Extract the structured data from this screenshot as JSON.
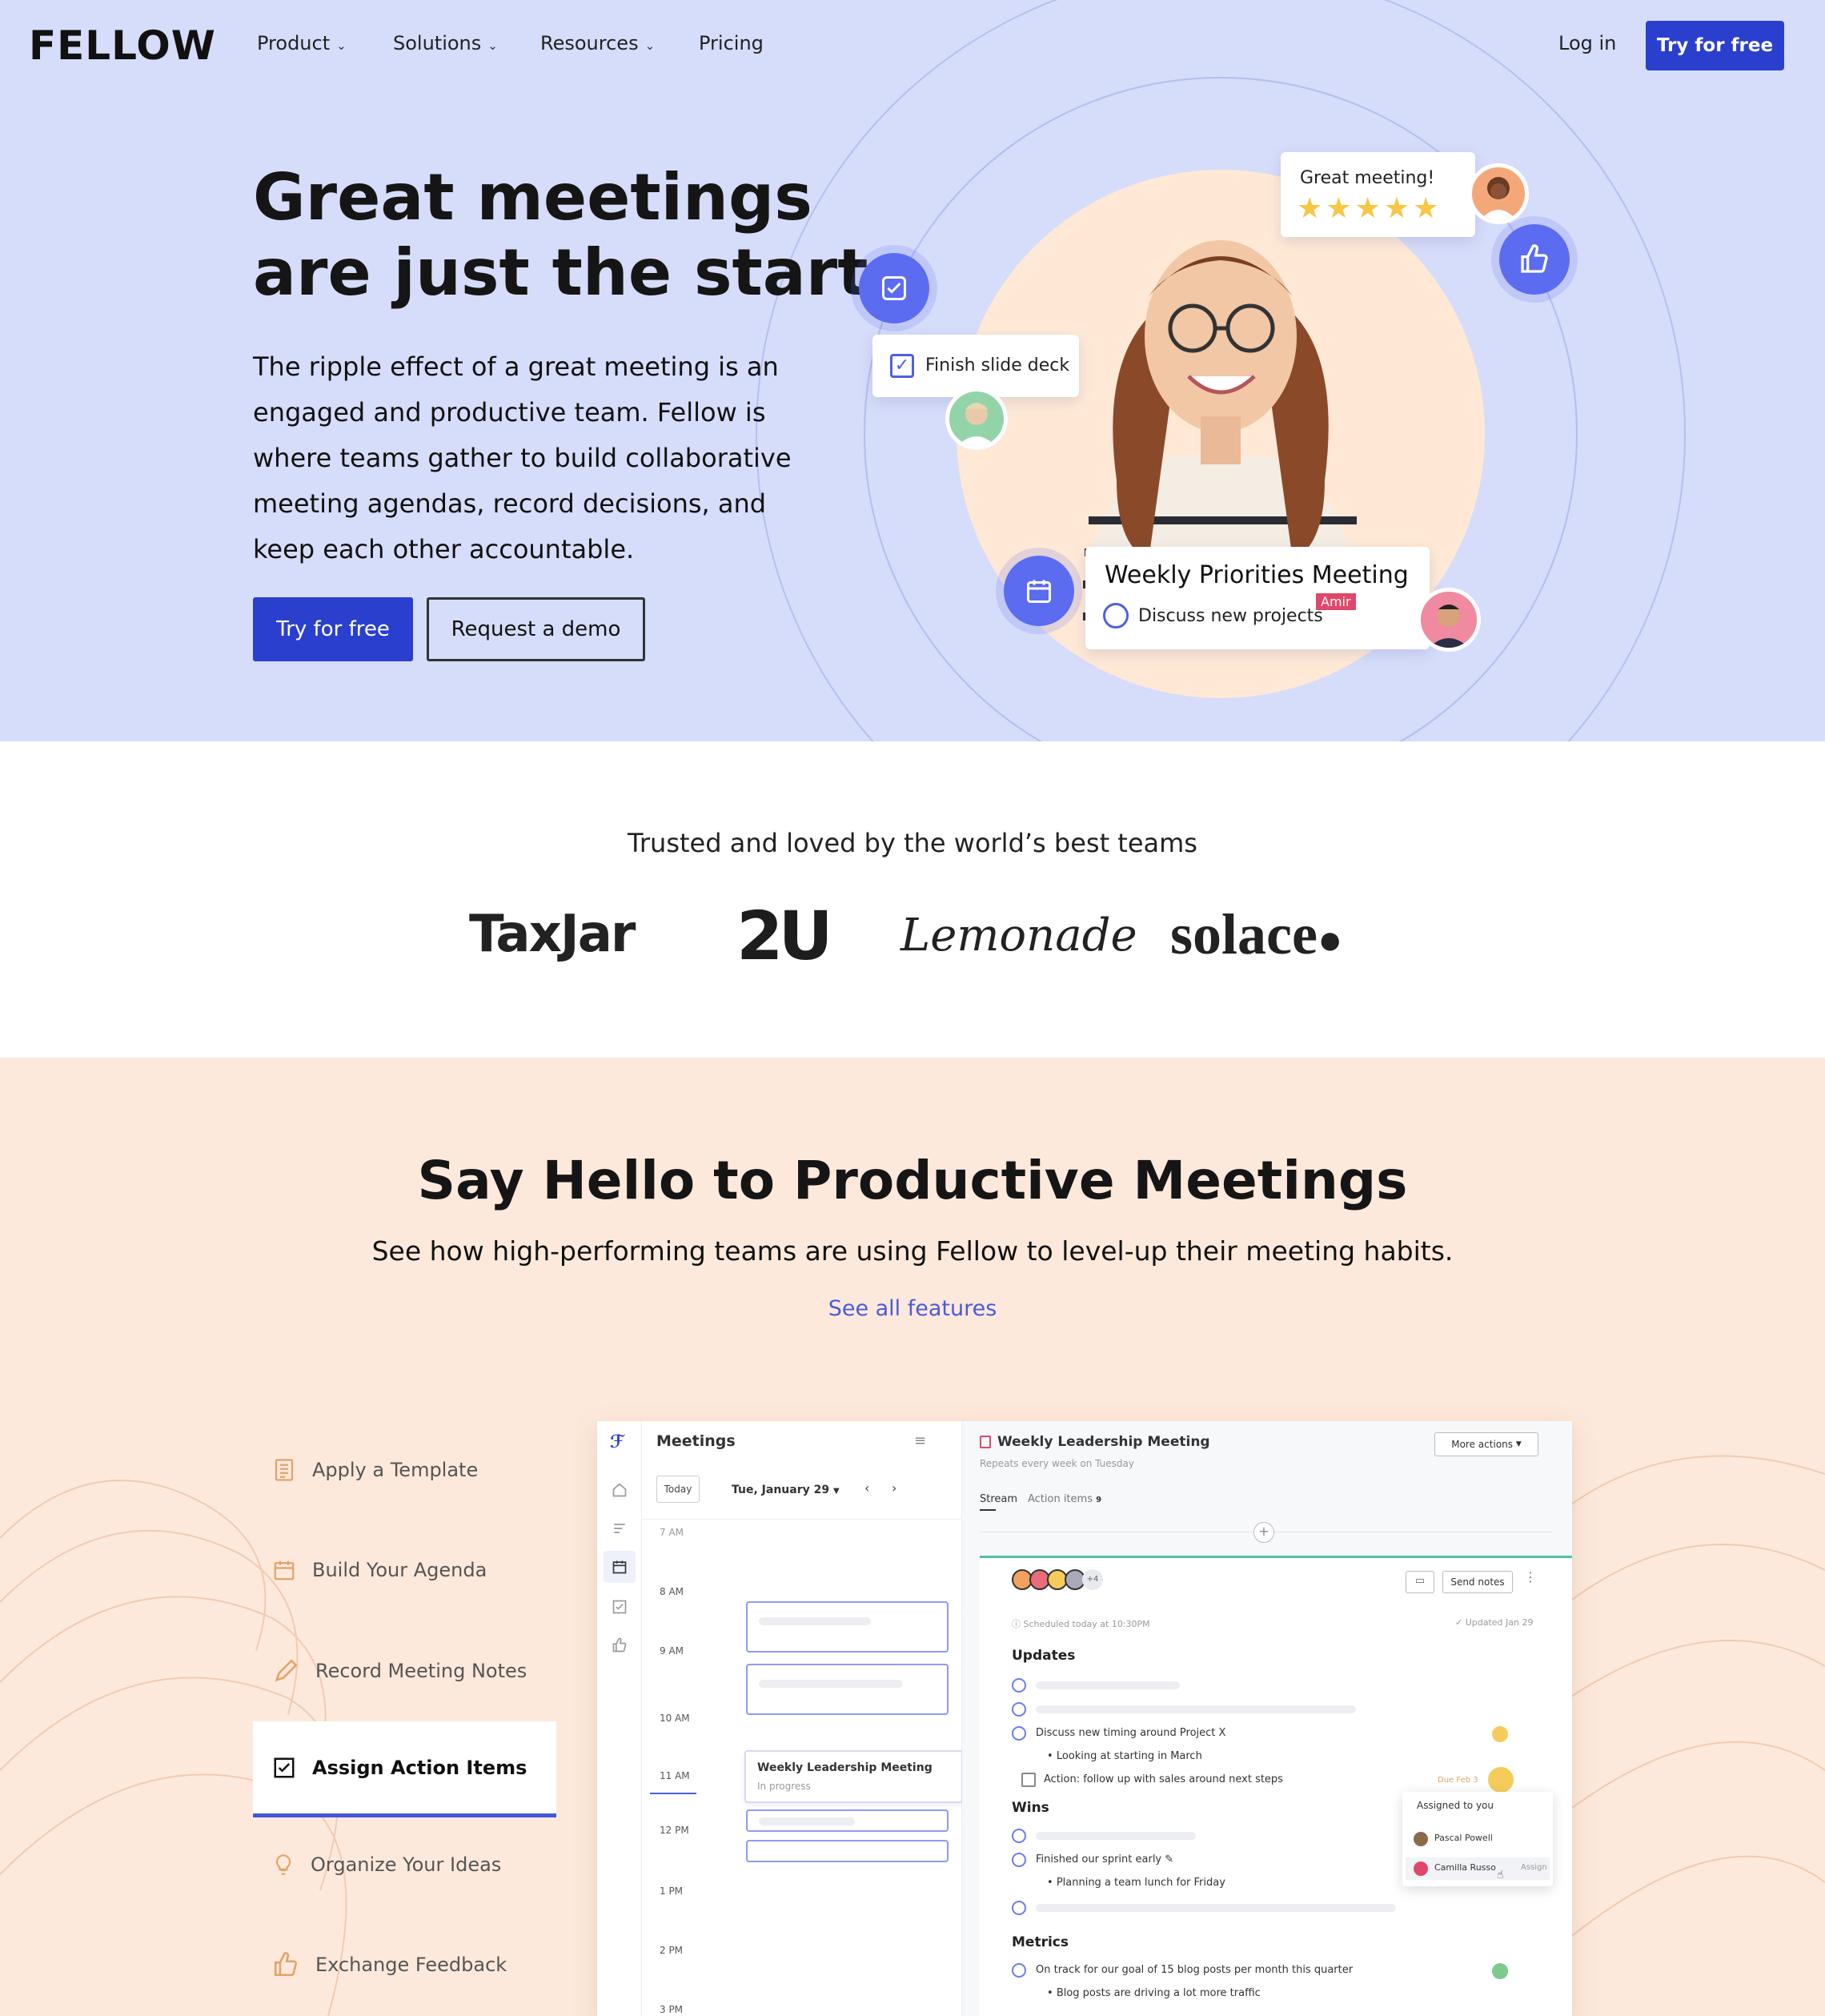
{
  "nav": {
    "logo": "FELLOW",
    "items": [
      {
        "label": "Product",
        "has_menu": true
      },
      {
        "label": "Solutions",
        "has_menu": true
      },
      {
        "label": "Resources",
        "has_menu": true
      },
      {
        "label": "Pricing",
        "has_menu": false
      }
    ],
    "login": "Log in",
    "cta": "Try for free"
  },
  "hero": {
    "title_line1": "Great meetings",
    "title_line2": "are just the start.",
    "body": "The ripple effect of a great meeting is an engaged and productive team. Fellow is where teams gather to build collaborative meeting agendas, record decisions, and keep each other accountable.",
    "cta_primary": "Try for free",
    "cta_secondary": "Request a demo",
    "rating_card": {
      "text": "Great meeting!",
      "stars": 5
    },
    "task_card": {
      "text": "Finish slide deck"
    },
    "meeting_card": {
      "title": "Weekly Priorities Meeting",
      "item": "Discuss new projects",
      "tag": "Amir"
    }
  },
  "trusted": {
    "title": "Trusted and loved by the world’s best teams",
    "logos": [
      "TaxJar",
      "2U",
      "Lemonade",
      "solace"
    ]
  },
  "features": {
    "title": "Say Hello to Productive Meetings",
    "subtitle": "See how high-performing teams are using Fellow to level-up their meeting habits.",
    "link": "See all features",
    "list": [
      {
        "label": "Apply a Template",
        "icon": "template-icon"
      },
      {
        "label": "Build Your Agenda",
        "icon": "calendar-icon"
      },
      {
        "label": "Record Meeting Notes",
        "icon": "pencil-icon"
      },
      {
        "label": "Assign Action Items",
        "icon": "checkbox-icon",
        "active": true
      },
      {
        "label": "Organize Your Ideas",
        "icon": "lightbulb-icon"
      },
      {
        "label": "Exchange Feedback",
        "icon": "thumbs-up-icon"
      }
    ]
  },
  "app": {
    "meetings_title": "Meetings",
    "today": "Today",
    "date": "Tue, January 29",
    "times": [
      "7 AM",
      "8 AM",
      "9 AM",
      "10 AM",
      "11 AM",
      "12 PM",
      "1 PM",
      "2 PM",
      "3 PM"
    ],
    "event_title": "Weekly Leadership Meeting",
    "event_status": "In progress",
    "meeting_title": "Weekly Leadership Meeting",
    "repeats": "Repeats every week on Tuesday",
    "more_actions": "More actions",
    "tabs": [
      "Stream",
      "Action items"
    ],
    "action_count": "9",
    "extra_attendees": "+4",
    "send_notes": "Send notes",
    "scheduled": "Scheduled today at 10:30PM",
    "updated": "Updated Jan 29",
    "sections": {
      "updates": "Updates",
      "wins": "Wins",
      "metrics": "Metrics"
    },
    "updates_item": "Discuss new timing around Project X",
    "updates_bullet": "Looking at starting in March",
    "action_item": "Action: follow up with sales around next steps",
    "due": "Due Feb 3",
    "wins_item": "Finished our sprint early ✎",
    "wins_bullet": "Planning a team lunch for Friday",
    "metrics_item": "On track for our goal of 15 blog posts per month this quarter",
    "metrics_bullet": "Blog posts are driving a lot more traffic",
    "assign_popup": {
      "title": "Assigned to you",
      "people": [
        "Pascal Powell",
        "Camilla Russo"
      ],
      "assign": "Assign"
    }
  }
}
